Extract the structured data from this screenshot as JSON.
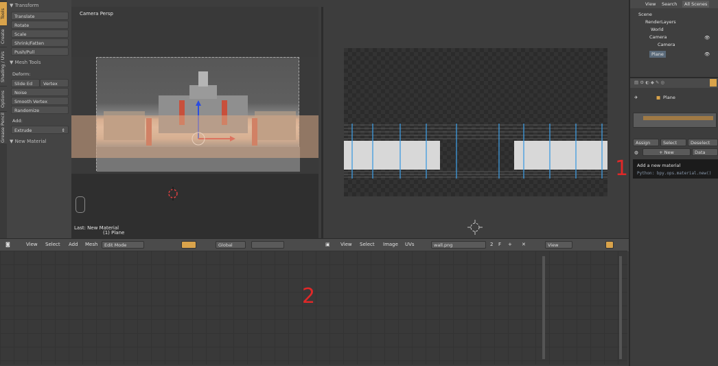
{
  "tool_tabs": [
    "Tools",
    "Create",
    "Shading / UVs",
    "Options",
    "Grease Pencil"
  ],
  "tool_panel": {
    "transform_header": "▼ Transform",
    "transform_buttons": [
      "Translate",
      "Rotate",
      "Scale",
      "Shrink/Fatten",
      "Push/Pull"
    ],
    "mesh_tools_header": "▼ Mesh Tools",
    "deform_label": "Deform:",
    "slide_edge": "Slide Ed",
    "vertex": "Vertex",
    "deform_buttons": [
      "Noise",
      "Smooth Vertex",
      "Randomize"
    ],
    "add_label": "Add:",
    "extrude": "Extrude",
    "new_material_header": "▼ New Material"
  },
  "viewport3d": {
    "title": "Camera Persp",
    "last_op": "Last: New Material",
    "object_label": "(1) Plane"
  },
  "header_3d": {
    "menus": [
      "View",
      "Select",
      "Add",
      "Mesh"
    ],
    "mode": "Edit Mode",
    "orientation": "Global"
  },
  "header_uv": {
    "menus": [
      "View",
      "Select",
      "Image",
      "UVs"
    ],
    "image_name": "wall.png",
    "users": "2",
    "fake_user": "F",
    "view": "View"
  },
  "outliner": {
    "menus": [
      "View",
      "Search",
      "All Scenes"
    ],
    "items": [
      "Scene",
      "RenderLayers",
      "World",
      "Camera",
      "Camera",
      "Plane"
    ]
  },
  "properties": {
    "object_name": "Plane",
    "assign": "Assign",
    "select": "Select",
    "deselect": "Deselect",
    "new": "New",
    "data": "Data",
    "tooltip_title": "Add a new material",
    "tooltip_python": "Python: bpy.ops.material.new()"
  },
  "annotations": {
    "one": "1",
    "two": "2"
  },
  "colors": {
    "accent": "#d9a34b",
    "annotation": "#e02828",
    "uv_line": "#3d9be0"
  }
}
